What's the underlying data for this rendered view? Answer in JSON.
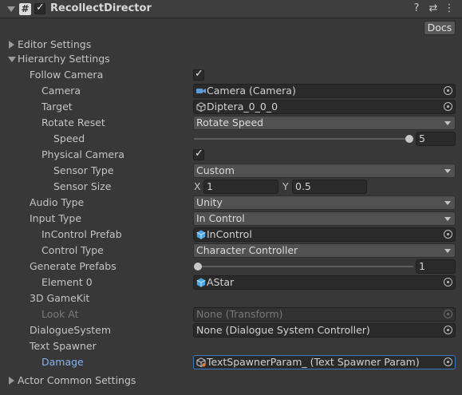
{
  "header": {
    "title": "RecollectDirector",
    "enabled": true,
    "script_glyph": "#",
    "help_label": "?",
    "settings_label": "⇄",
    "menu_label": "⋮"
  },
  "docs_label": "Docs",
  "sections": {
    "editor": "Editor Settings",
    "hierarchy": "Hierarchy Settings",
    "actor": "Actor Common Settings"
  },
  "fields": {
    "follow_camera": {
      "label": "Follow Camera",
      "checked": true
    },
    "camera": {
      "label": "Camera",
      "value": "Camera (Camera)",
      "icon": "camera-icon"
    },
    "target": {
      "label": "Target",
      "value": "Diptera_0_0_0",
      "icon": "gameobject-icon"
    },
    "rotate_reset": {
      "label": "Rotate Reset",
      "value": "Rotate Speed"
    },
    "speed": {
      "label": "Speed",
      "value": "5",
      "fraction": 1.0
    },
    "physical_camera": {
      "label": "Physical Camera",
      "checked": true
    },
    "sensor_type": {
      "label": "Sensor Type",
      "value": "Custom"
    },
    "sensor_size": {
      "label": "Sensor Size",
      "x_label": "X",
      "x": "1",
      "y_label": "Y",
      "y": "0.5"
    },
    "audio_type": {
      "label": "Audio Type",
      "value": "Unity"
    },
    "input_type": {
      "label": "Input Type",
      "value": "In Control"
    },
    "incontrol_prefab": {
      "label": "InControl Prefab",
      "value": "InControl",
      "icon": "prefab-icon"
    },
    "control_type": {
      "label": "Control Type",
      "value": "Character Controller"
    },
    "generate_prefabs": {
      "label": "Generate Prefabs",
      "value": "1",
      "fraction": 0.0
    },
    "element0": {
      "label": "Element 0",
      "value": "AStar",
      "icon": "prefab-icon"
    },
    "gamekit": {
      "label": "3D GameKit"
    },
    "look_at": {
      "label": "Look At",
      "value": "None (Transform)"
    },
    "dialogue": {
      "label": "DialogueSystem",
      "value": "None (Dialogue System Controller)"
    },
    "text_spawner": {
      "label": "Text Spawner"
    },
    "damage": {
      "label": "Damage",
      "value": "TextSpawnerParam_ (Text Spawner Param)",
      "icon": "scriptable-object-icon"
    }
  },
  "colors": {
    "background": "#383838",
    "field": "#2a2a2a",
    "dropdown": "#515151",
    "accent_blue": "#7fb3f0",
    "selection": "#3a79bb"
  }
}
